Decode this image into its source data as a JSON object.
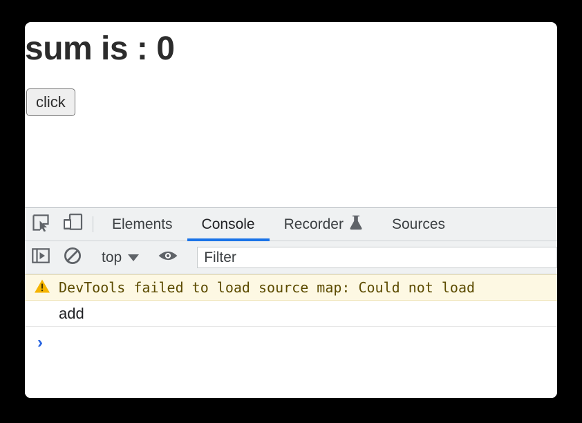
{
  "page": {
    "heading": "sum is : 0",
    "button_label": "click"
  },
  "devtools": {
    "tabbar": {
      "inspect_icon": "inspect-cursor-icon",
      "device_toggle_icon": "device-toolbar-icon",
      "tabs": [
        {
          "label": "Elements",
          "active": false,
          "icon": ""
        },
        {
          "label": "Console",
          "active": true,
          "icon": ""
        },
        {
          "label": "Recorder",
          "active": false,
          "icon": "flask-icon"
        },
        {
          "label": "Sources",
          "active": false,
          "icon": ""
        }
      ]
    },
    "console_toolbar": {
      "sidebar_toggle_icon": "console-sidebar-icon",
      "clear_console_icon": "clear-console-icon",
      "context_label": "top",
      "context_caret_icon": "chevron-down-icon",
      "live_expression_icon": "eye-icon",
      "filter_placeholder": "Filter",
      "filter_value": ""
    },
    "messages": [
      {
        "type": "warning",
        "icon": "warning-triangle-icon",
        "text": "DevTools failed to load source map: Could not load"
      },
      {
        "type": "log",
        "text": "add"
      }
    ],
    "prompt": {
      "chevron": "›",
      "value": ""
    }
  },
  "colors": {
    "accent_blue": "#1a73e8",
    "prompt_blue": "#2764e0",
    "warning_bg": "#fdf8e3",
    "warning_text": "#5c4b00",
    "toolbar_bg": "#eff1f2",
    "page_bg": "#ffffff",
    "outer_bg": "#000000"
  }
}
